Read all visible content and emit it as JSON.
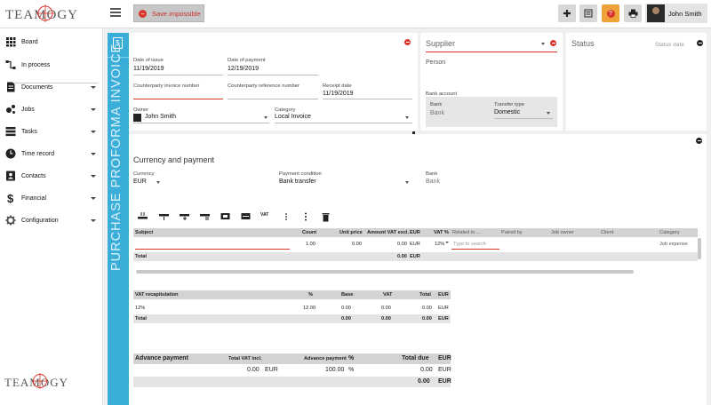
{
  "app": {
    "logo_text": "TEAMOGY",
    "save_label": "Save impossible",
    "user_name": "John Smith",
    "help_label": "?",
    "toolbar_icons": [
      "plus-icon",
      "notes-icon",
      "help-icon",
      "print-icon"
    ]
  },
  "sidebar": {
    "items": [
      {
        "label": "Board",
        "icon": "grid-icon",
        "caret": false
      },
      {
        "label": "In process",
        "icon": "flow-icon",
        "caret": false
      },
      {
        "label": "Documents",
        "icon": "document-icon",
        "caret": true
      },
      {
        "label": "Jobs",
        "icon": "jobs-icon",
        "caret": true
      },
      {
        "label": "Tasks",
        "icon": "tasks-icon",
        "caret": true
      },
      {
        "label": "Time record",
        "icon": "clock-icon",
        "caret": true
      },
      {
        "label": "Contacts",
        "icon": "contacts-icon",
        "caret": true
      },
      {
        "label": "Financial",
        "icon": "dollar-icon",
        "caret": true
      },
      {
        "label": "Configuration",
        "icon": "gear-icon",
        "caret": true
      }
    ]
  },
  "document": {
    "vertical_title": "PURCHASE PROFORMA INVOICE",
    "date_of_issue_label": "Date of issue",
    "date_of_issue": "11/19/2019",
    "date_of_payment_label": "Date of payment",
    "date_of_payment": "12/19/2019",
    "counterparty_invoice_label": "Counterparty invoice number",
    "counterparty_reference_label": "Counterparty reference number",
    "receipt_date_label": "Receipt date",
    "receipt_date": "11/19/2019",
    "owner_label": "Owner",
    "owner": "John Smith",
    "category_label": "Category",
    "category": "Local Invoice"
  },
  "supplier": {
    "title": "Supplier",
    "person": "Person",
    "bank_account_label": "Bank account",
    "bank_label": "Bank",
    "bank_placeholder": "Bank",
    "transfer_type_label": "Transfer type",
    "transfer_type": "Domestic"
  },
  "status": {
    "title": "Status",
    "status_date_placeholder": "Status date"
  },
  "currency": {
    "title": "Currency and payment",
    "currency_label": "Currency",
    "currency": "EUR",
    "payment_condition_label": "Payment condition",
    "payment_condition": "Bank transfer",
    "bank_label": "Bank",
    "bank_placeholder": "Bank",
    "vat_tool_label": "VAT"
  },
  "items_table": {
    "headers": [
      "Subject",
      "Count",
      "Unit price",
      "Amount VAT excl.",
      "EUR",
      "VAT %",
      "Related to ...",
      "Paired by",
      "Job owner",
      "Client",
      "Category"
    ],
    "row": {
      "subject": "",
      "count": "1.00",
      "unit_price": "0.00",
      "amount": "0.00",
      "currency": "EUR",
      "vat": "12%",
      "related_placeholder": "Type to search",
      "category": "Job expense"
    },
    "total_label": "Total",
    "total_amount": "0.00",
    "total_currency": "EUR"
  },
  "vat_table": {
    "headers": [
      "VAT recapitulation",
      "%",
      "Base",
      "VAT",
      "Total",
      "EUR"
    ],
    "row": [
      "12%",
      "12.00",
      "0.00",
      "0.00",
      "0.00",
      "EUR"
    ],
    "total": [
      "Total",
      "0.00",
      "0.00",
      "0.00",
      "EUR"
    ]
  },
  "advance_table": {
    "headers": [
      "Advance payment",
      "Total VAT incl.",
      "Advance payment",
      "%",
      "Total due",
      "EUR"
    ],
    "row": [
      "0.00",
      "EUR",
      "100.00",
      "%",
      "0.00",
      "EUR"
    ],
    "total": [
      "0.00",
      "EUR"
    ]
  },
  "colors": {
    "accent": "#3aaed8",
    "danger": "#d9352b",
    "warning": "#f0a23a"
  }
}
